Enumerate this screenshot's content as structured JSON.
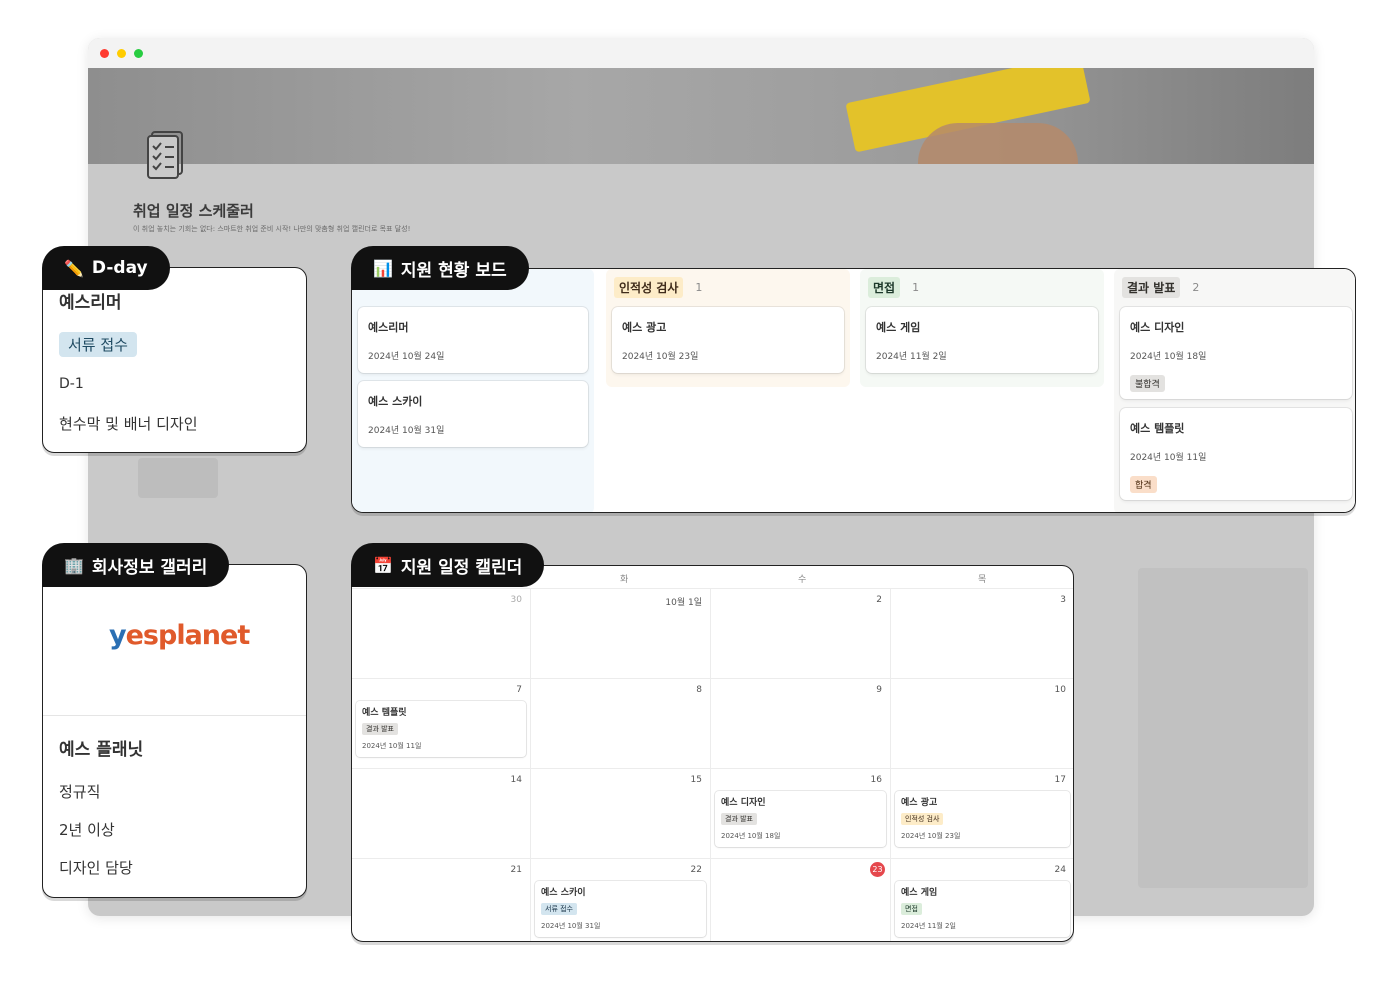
{
  "background_page": {
    "title": "취업 일정 스케줄러",
    "description": "이 취업 놓치는 기회는 없다: 스마트한 취업 준비 시작! 나만의 맞춤형 취업 캘린더로 목표 달성!"
  },
  "dday_card": {
    "tab_icon": "✏️",
    "tab_label": "D-day",
    "company": "예스리머",
    "status": "서류 접수",
    "dday": "D-1",
    "task": "현수막 및 배너 디자인"
  },
  "board_card": {
    "tab_icon": "📊",
    "tab_label": "지원 현황 보드",
    "columns": [
      {
        "label": "",
        "count": "",
        "cards": [
          {
            "title": "예스리머",
            "date": "2024년 10월 24일"
          },
          {
            "title": "예스 스카이",
            "date": "2024년 10월 31일"
          }
        ]
      },
      {
        "label": "인적성 검사",
        "count": "1",
        "cards": [
          {
            "title": "예스 광고",
            "date": "2024년 10월 23일"
          }
        ]
      },
      {
        "label": "면접",
        "count": "1",
        "cards": [
          {
            "title": "예스 게임",
            "date": "2024년 11월 2일"
          }
        ]
      },
      {
        "label": "결과 발표",
        "count": "2",
        "cards": [
          {
            "title": "예스 디자인",
            "date": "2024년 10월 18일",
            "tag": "불합격"
          },
          {
            "title": "예스 템플릿",
            "date": "2024년 10월 11일",
            "tag": "합격"
          }
        ]
      }
    ]
  },
  "company_card": {
    "tab_icon": "🏢",
    "tab_label": "회사정보 갤러리",
    "logo_prefix": "y",
    "logo_rest": "esplanet",
    "name": "예스 플래닛",
    "employment_type": "정규직",
    "experience": "2년 이상",
    "role": "디자인 담당"
  },
  "calendar_card": {
    "tab_icon": "📅",
    "tab_label": "지원 일정 캘린더",
    "weekday_headers": [
      "화",
      "수",
      "목"
    ],
    "weeks": [
      [
        "30",
        "10월 1일",
        "2",
        "3"
      ],
      [
        "7",
        "8",
        "9",
        "10"
      ],
      [
        "14",
        "15",
        "16",
        "17"
      ],
      [
        "21",
        "22",
        "23",
        "24"
      ]
    ],
    "today": "23",
    "events": {
      "w1d0": {
        "title": "예스 템플릿",
        "tag": "결과 발표",
        "date": "2024년 10월 11일"
      },
      "w2d2": {
        "title": "예스 디자인",
        "tag": "결과 발표",
        "date": "2024년 10월 18일"
      },
      "w2d3": {
        "title": "예스 광고",
        "tag": "인적성 검사",
        "date": "2024년 10월 23일"
      },
      "w3d1": {
        "title": "예스 스카이",
        "tag": "서류 접수",
        "date": "2024년 10월 31일"
      },
      "w3d3": {
        "title": "예스 게임",
        "tag": "면접",
        "date": "2024년 11월 2일"
      }
    }
  },
  "colors": {
    "tab_bg": "#111111",
    "today_badge": "#e5484d",
    "logo_orange": "#e05a2b",
    "logo_blue": "#2b6fb3"
  }
}
